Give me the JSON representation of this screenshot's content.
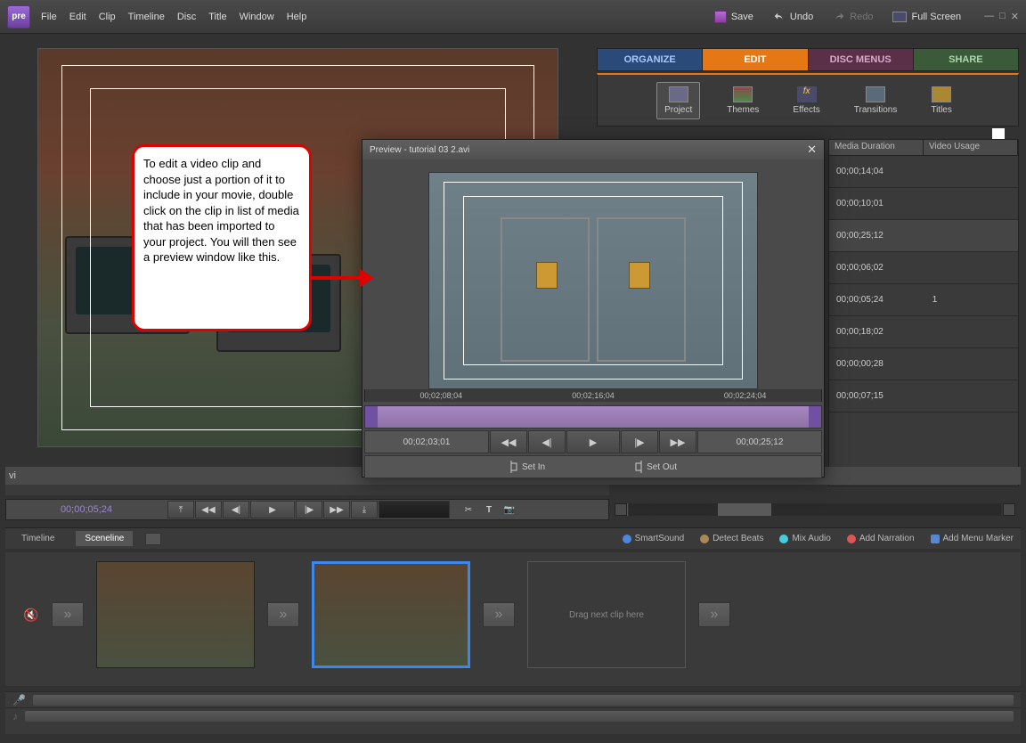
{
  "app": {
    "badge": "pre"
  },
  "menu": [
    "File",
    "Edit",
    "Clip",
    "Timeline",
    "Disc",
    "Title",
    "Window",
    "Help"
  ],
  "titlebar": {
    "save": "Save",
    "undo": "Undo",
    "redo": "Redo",
    "fullscreen": "Full Screen"
  },
  "main_tabs": {
    "organize": "ORGANIZE",
    "edit": "EDIT",
    "disc": "DISC MENUS",
    "share": "SHARE"
  },
  "edit_tools": {
    "project": "Project",
    "themes": "Themes",
    "effects": "Effects",
    "transitions": "Transitions",
    "titles": "Titles"
  },
  "media": {
    "col_duration": "Media Duration",
    "col_usage": "Video Usage",
    "rows": [
      {
        "d": "00;00;14;04",
        "u": ""
      },
      {
        "d": "00;00;10;01",
        "u": ""
      },
      {
        "d": "00;00;25;12",
        "u": ""
      },
      {
        "d": "00;00;06;02",
        "u": ""
      },
      {
        "d": "00;00;05;24",
        "u": "1"
      },
      {
        "d": "00;00;18;02",
        "u": ""
      },
      {
        "d": "00;00;00;28",
        "u": ""
      },
      {
        "d": "00;00;07;15",
        "u": ""
      }
    ]
  },
  "callout": "To edit a video clip and choose just a portion of it to include in your movie, double click on the clip in list of media that has been imported to your project. You will then see a preview window like this.",
  "preview": {
    "title": "Preview - tutorial 03 2.avi",
    "ruler": [
      "00;02;08;04",
      "00;02;16;04",
      "00;02;24;04"
    ],
    "tc_left": "00;02;03;01",
    "tc_right": "00;00;25;12",
    "set_in": "Set In",
    "set_out": "Set Out"
  },
  "transport": {
    "tc": "00;00;05;24"
  },
  "sceneline_bar": {
    "timeline": "Timeline",
    "sceneline": "Sceneline",
    "smartsound": "SmartSound",
    "detect": "Detect Beats",
    "mix": "Mix Audio",
    "narration": "Add Narration",
    "marker": "Add Menu Marker"
  },
  "storyboard": {
    "drop": "Drag next clip here"
  },
  "below_monitor_label": "vi"
}
